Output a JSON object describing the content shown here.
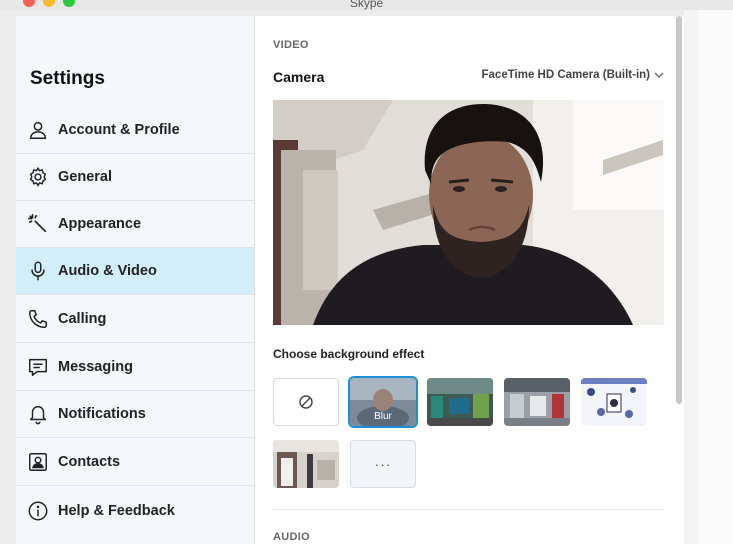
{
  "window": {
    "title": "Skype"
  },
  "sidebar": {
    "title": "Settings",
    "items": [
      {
        "label": "Account & Profile",
        "icon": "person-icon"
      },
      {
        "label": "General",
        "icon": "gear-icon"
      },
      {
        "label": "Appearance",
        "icon": "magic-wand-icon"
      },
      {
        "label": "Audio & Video",
        "icon": "microphone-icon",
        "active": true
      },
      {
        "label": "Calling",
        "icon": "phone-icon"
      },
      {
        "label": "Messaging",
        "icon": "chat-icon"
      },
      {
        "label": "Notifications",
        "icon": "bell-icon"
      },
      {
        "label": "Contacts",
        "icon": "contact-card-icon"
      },
      {
        "label": "Help & Feedback",
        "icon": "info-icon"
      }
    ]
  },
  "video": {
    "section_label": "VIDEO",
    "camera_label": "Camera",
    "camera_selected": "FaceTime HD Camera (Built-in)",
    "background_label": "Choose background effect",
    "effects": [
      {
        "kind": "none",
        "icon": "no-effect-icon"
      },
      {
        "kind": "blur",
        "label": "Blur",
        "selected": true
      },
      {
        "kind": "image",
        "name": "office"
      },
      {
        "kind": "image",
        "name": "workshop"
      },
      {
        "kind": "image",
        "name": "pattern"
      },
      {
        "kind": "image",
        "name": "room"
      },
      {
        "kind": "more",
        "label": "···"
      }
    ]
  },
  "audio": {
    "section_label": "AUDIO"
  },
  "colors": {
    "accent": "#1d8fd6",
    "active_nav": "#d3eefb",
    "sidebar_bg": "#f6f7fb"
  }
}
